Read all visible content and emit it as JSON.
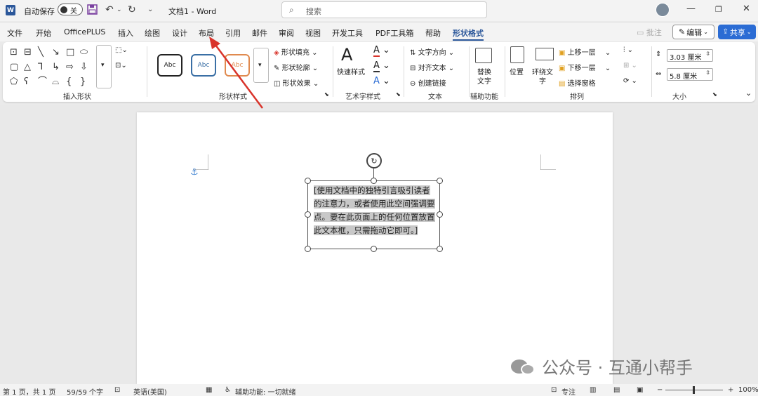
{
  "titlebar": {
    "logo": "W",
    "autosave_label": "自动保存",
    "toggle_state": "关",
    "doc_title": "文档1 - Word",
    "search_placeholder": "搜索",
    "icons": [
      "save-icon",
      "undo-icon",
      "redo-icon",
      "customize-qat-icon",
      "search-icon",
      "minimize-icon",
      "restore-icon",
      "close-icon"
    ]
  },
  "tabs": [
    {
      "label": "文件"
    },
    {
      "label": "开始"
    },
    {
      "label": "OfficePLUS"
    },
    {
      "label": "插入"
    },
    {
      "label": "绘图"
    },
    {
      "label": "设计"
    },
    {
      "label": "布局"
    },
    {
      "label": "引用"
    },
    {
      "label": "邮件"
    },
    {
      "label": "审阅"
    },
    {
      "label": "视图"
    },
    {
      "label": "开发工具"
    },
    {
      "label": "PDF工具箱"
    },
    {
      "label": "帮助"
    },
    {
      "label": "形状格式"
    }
  ],
  "header_actions": {
    "comment": "批注",
    "edit": "编辑",
    "share": "共享"
  },
  "ribbon": {
    "insert_shapes_label": "插入形状",
    "shape_styles_label": "形状样式",
    "abc": "Abc",
    "shape_fill": "形状填充",
    "shape_outline": "形状轮廓",
    "shape_effects": "形状效果",
    "wordart_label": "艺术字样式",
    "quick_styles": "快速样式",
    "text_direction": "文字方向",
    "align_text": "对齐文本",
    "create_link": "创建链接",
    "text_label": "文本",
    "alt_text_line1": "替换",
    "alt_text_line2": "文字",
    "accessibility_label": "辅助功能",
    "position": "位置",
    "wrap_text_line1": "环绕文",
    "wrap_text_line2": "字",
    "bring_forward": "上移一层",
    "send_backward": "下移一层",
    "selection_pane": "选择窗格",
    "arrange_label": "排列",
    "height_value": "3.03 厘米",
    "width_value": "5.8 厘米",
    "size_label": "大小"
  },
  "document": {
    "textbox_text": "[使用文档中的独特引言吸引读者的注意力，或者使用此空间强调要点。要在此页面上的任何位置放置此文本框，只需拖动它即可。]"
  },
  "watermark": "公众号 · 互通小帮手",
  "statusbar": {
    "page": "第 1 页，共 1 页",
    "words": "59/59 个字",
    "language": "英语(美国)",
    "accessibility": "辅助功能: 一切就绪",
    "focus": "专注",
    "zoom": "100%"
  },
  "colors": {
    "accent": "#2b579a",
    "share": "#2b6cd4",
    "arrow": "#d9342b"
  }
}
